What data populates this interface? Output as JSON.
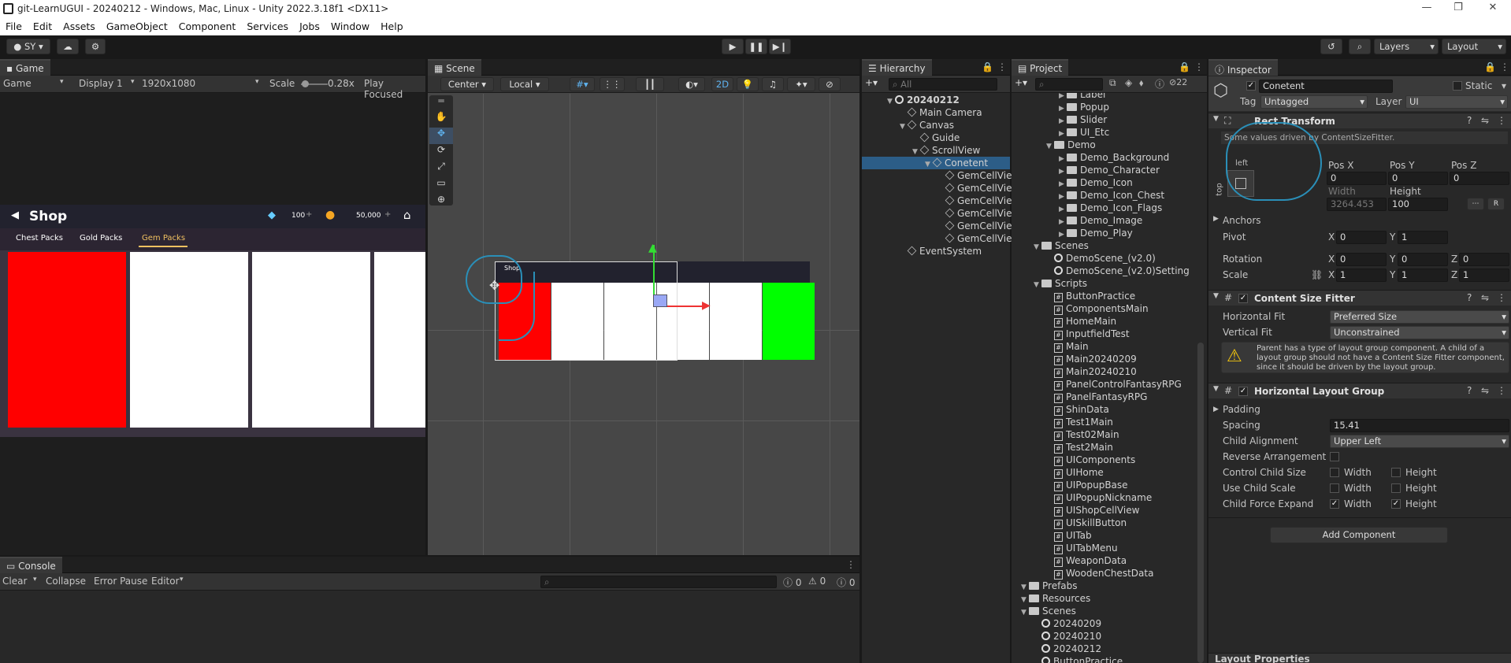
{
  "window": {
    "title": "git-LearnUGUI - 20240212 - Windows, Mac, Linux - Unity 2022.3.18f1 <DX11>",
    "minimize": "—",
    "maximize": "❐",
    "close": "✕"
  },
  "menu": [
    "File",
    "Edit",
    "Assets",
    "GameObject",
    "Component",
    "Services",
    "Jobs",
    "Window",
    "Help"
  ],
  "toolbar": {
    "account": "SY",
    "layers": "Layers",
    "layout": "Layout"
  },
  "game": {
    "tab": "Game",
    "mode": "Game",
    "display": "Display 1",
    "resolution": "1920x1080",
    "scale_label": "Scale",
    "scale_value": "0.28x",
    "play_focused": "Play Focused",
    "shop": {
      "title": "Shop",
      "gems": "100",
      "gold": "50,000",
      "tabs": [
        "Chest Packs",
        "Gold Packs",
        "Gem Packs"
      ]
    }
  },
  "scene": {
    "tab": "Scene",
    "pivot": "Center",
    "space": "Local",
    "mode2d": "2D",
    "mini_title": "Shop"
  },
  "hierarchy": {
    "tab": "Hierarchy",
    "search_placeholder": "All",
    "items": [
      {
        "label": "20240212",
        "type": "scene",
        "depth": 0
      },
      {
        "label": "Main Camera",
        "type": "go",
        "depth": 1
      },
      {
        "label": "Canvas",
        "type": "go",
        "depth": 1
      },
      {
        "label": "Guide",
        "type": "go",
        "depth": 2
      },
      {
        "label": "ScrollView",
        "type": "go",
        "depth": 2
      },
      {
        "label": "Conetent",
        "type": "go",
        "depth": 3,
        "selected": true
      },
      {
        "label": "GemCellVie",
        "type": "go",
        "depth": 4
      },
      {
        "label": "GemCellVie",
        "type": "go",
        "depth": 4
      },
      {
        "label": "GemCellVie",
        "type": "go",
        "depth": 4
      },
      {
        "label": "GemCellVie",
        "type": "go",
        "depth": 4
      },
      {
        "label": "GemCellVie",
        "type": "go",
        "depth": 4
      },
      {
        "label": "GemCellVie",
        "type": "go",
        "depth": 4
      },
      {
        "label": "EventSystem",
        "type": "go",
        "depth": 1
      }
    ]
  },
  "project": {
    "tab": "Project",
    "count": "22",
    "items": [
      {
        "label": "Label",
        "type": "fold",
        "depth": 3
      },
      {
        "label": "Popup",
        "type": "fold",
        "depth": 3
      },
      {
        "label": "Slider",
        "type": "fold",
        "depth": 3
      },
      {
        "label": "UI_Etc",
        "type": "fold",
        "depth": 3
      },
      {
        "label": "Demo",
        "type": "fold",
        "depth": 2
      },
      {
        "label": "Demo_Background",
        "type": "fold",
        "depth": 3
      },
      {
        "label": "Demo_Character",
        "type": "fold",
        "depth": 3
      },
      {
        "label": "Demo_Icon",
        "type": "fold",
        "depth": 3
      },
      {
        "label": "Demo_Icon_Chest",
        "type": "fold",
        "depth": 3
      },
      {
        "label": "Demo_Icon_Flags",
        "type": "fold",
        "depth": 3
      },
      {
        "label": "Demo_Image",
        "type": "fold",
        "depth": 3
      },
      {
        "label": "Demo_Play",
        "type": "fold",
        "depth": 3
      },
      {
        "label": "Scenes",
        "type": "fold",
        "depth": 1
      },
      {
        "label": "DemoScene_(v2.0)",
        "type": "scene",
        "depth": 2
      },
      {
        "label": "DemoScene_(v2.0)Setting",
        "type": "scene",
        "depth": 2
      },
      {
        "label": "Scripts",
        "type": "fold",
        "depth": 1
      },
      {
        "label": "ButtonPractice",
        "type": "cs",
        "depth": 2
      },
      {
        "label": "ComponentsMain",
        "type": "cs",
        "depth": 2
      },
      {
        "label": "HomeMain",
        "type": "cs",
        "depth": 2
      },
      {
        "label": "InputfieldTest",
        "type": "cs",
        "depth": 2
      },
      {
        "label": "Main",
        "type": "cs",
        "depth": 2
      },
      {
        "label": "Main20240209",
        "type": "cs",
        "depth": 2
      },
      {
        "label": "Main20240210",
        "type": "cs",
        "depth": 2
      },
      {
        "label": "PanelControlFantasyRPG",
        "type": "cs",
        "depth": 2
      },
      {
        "label": "PanelFantasyRPG",
        "type": "cs",
        "depth": 2
      },
      {
        "label": "ShinData",
        "type": "cs",
        "depth": 2
      },
      {
        "label": "Test1Main",
        "type": "cs",
        "depth": 2
      },
      {
        "label": "Test02Main",
        "type": "cs",
        "depth": 2
      },
      {
        "label": "Test2Main",
        "type": "cs",
        "depth": 2
      },
      {
        "label": "UIComponents",
        "type": "cs",
        "depth": 2
      },
      {
        "label": "UIHome",
        "type": "cs",
        "depth": 2
      },
      {
        "label": "UIPopupBase",
        "type": "cs",
        "depth": 2
      },
      {
        "label": "UIPopupNickname",
        "type": "cs",
        "depth": 2
      },
      {
        "label": "UIShopCellView",
        "type": "cs",
        "depth": 2
      },
      {
        "label": "UISkillButton",
        "type": "cs",
        "depth": 2
      },
      {
        "label": "UITab",
        "type": "cs",
        "depth": 2
      },
      {
        "label": "UITabMenu",
        "type": "cs",
        "depth": 2
      },
      {
        "label": "WeaponData",
        "type": "cs",
        "depth": 2
      },
      {
        "label": "WoodenChestData",
        "type": "cs",
        "depth": 2
      },
      {
        "label": "Prefabs",
        "type": "fold",
        "depth": 0
      },
      {
        "label": "Resources",
        "type": "fold",
        "depth": 0
      },
      {
        "label": "Scenes",
        "type": "fold",
        "depth": 0
      },
      {
        "label": "20240209",
        "type": "scene",
        "depth": 1
      },
      {
        "label": "20240210",
        "type": "scene",
        "depth": 1
      },
      {
        "label": "20240212",
        "type": "scene",
        "depth": 1
      },
      {
        "label": "ButtonPractice",
        "type": "scene",
        "depth": 1
      }
    ]
  },
  "console": {
    "tab": "Console",
    "clear": "Clear",
    "collapse": "Collapse",
    "error_pause": "Error Pause",
    "editor": "Editor",
    "c1": "0",
    "c2": "0",
    "c3": "0"
  },
  "inspector": {
    "tab": "Inspector",
    "object_name": "Conetent",
    "static": "Static",
    "tag_label": "Tag",
    "tag_value": "Untagged",
    "layer_label": "Layer",
    "layer_value": "UI",
    "rect": {
      "title": "Rect Transform",
      "note": "Some values driven by ContentSizeFitter.",
      "anchor_left": "left",
      "anchor_top": "top",
      "posx_label": "Pos X",
      "posy_label": "Pos Y",
      "posz_label": "Pos Z",
      "posx": "0",
      "posy": "0",
      "posz": "0",
      "width_label": "Width",
      "height_label": "Height",
      "width": "3264.453",
      "height": "100",
      "anchors": "Anchors",
      "pivot": "Pivot",
      "pivot_x": "0",
      "pivot_y": "1",
      "rotation": "Rotation",
      "rot_x": "0",
      "rot_y": "0",
      "rot_z": "0",
      "scale": "Scale",
      "scale_x": "1",
      "scale_y": "1",
      "scale_z": "1",
      "x": "X",
      "y": "Y",
      "z": "Z"
    },
    "csf": {
      "title": "Content Size Fitter",
      "hfit_label": "Horizontal Fit",
      "hfit": "Preferred Size",
      "vfit_label": "Vertical Fit",
      "vfit": "Unconstrained",
      "warning": "Parent has a type of layout group component. A child of a layout group should not have a Content Size Fitter component, since it should be driven by the layout group."
    },
    "hlg": {
      "title": "Horizontal Layout Group",
      "padding": "Padding",
      "spacing_label": "Spacing",
      "spacing": "15.41",
      "child_alignment_label": "Child Alignment",
      "child_alignment": "Upper Left",
      "reverse": "Reverse Arrangement",
      "control": "Control Child Size",
      "use_scale": "Use Child Scale",
      "force": "Child Force Expand",
      "width": "Width",
      "height": "Height"
    },
    "add_component": "Add Component",
    "layout_properties": "Layout Properties"
  },
  "colors": {
    "accent": "#2c5d87",
    "red": "#ff0000",
    "green": "#00ff00",
    "annotation": "#2a8fb8"
  }
}
